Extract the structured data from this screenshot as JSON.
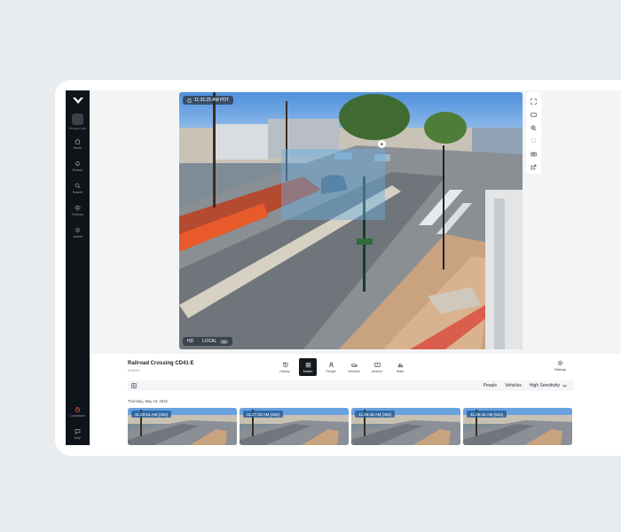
{
  "sidebar": {
    "org_label": "Verkada Labs",
    "items": [
      {
        "label": "Home",
        "icon": "home-icon"
      },
      {
        "label": "Events",
        "icon": "bell-icon"
      },
      {
        "label": "Search",
        "icon": "search-icon"
      },
      {
        "label": "Devices",
        "icon": "devices-icon"
      },
      {
        "label": "Admin",
        "icon": "admin-gear-icon"
      }
    ],
    "lockdown_label": "Lockdown",
    "help_label": "Help"
  },
  "video": {
    "timestamp": "11:31:25 AM PDT",
    "quality": "HD",
    "source": "LOCAL",
    "badge": "5X"
  },
  "camera": {
    "name": "Railroad Crossing CD41-E",
    "subtitle": "Exterior"
  },
  "modes": [
    {
      "label": "History",
      "icon": "history-icon",
      "active": false
    },
    {
      "label": "Motion",
      "icon": "motion-icon",
      "active": true
    },
    {
      "label": "People",
      "icon": "people-icon",
      "active": false
    },
    {
      "label": "Vehicles",
      "icon": "vehicle-icon",
      "active": false
    },
    {
      "label": "Archive",
      "icon": "archive-icon",
      "active": false
    },
    {
      "label": "Stats",
      "icon": "stats-icon",
      "active": false
    }
  ],
  "settings_label": "Settings",
  "filters": {
    "people": "People",
    "vehicles": "Vehicles",
    "sensitivity": "High Sensitivity"
  },
  "date_label": "Thursday, May 19, 2022",
  "thumbnails": [
    {
      "time": "11:28:54 AM (45s)"
    },
    {
      "time": "11:27:33 AM (45s)"
    },
    {
      "time": "11:26:48 AM (30s)"
    },
    {
      "time": "11:25:45 AM (52s)"
    }
  ],
  "colors": {
    "sidebar": "#0f141a",
    "motion_zone": "#68afe2",
    "lockdown": "#e0564a",
    "active_mode": "#151a20"
  }
}
